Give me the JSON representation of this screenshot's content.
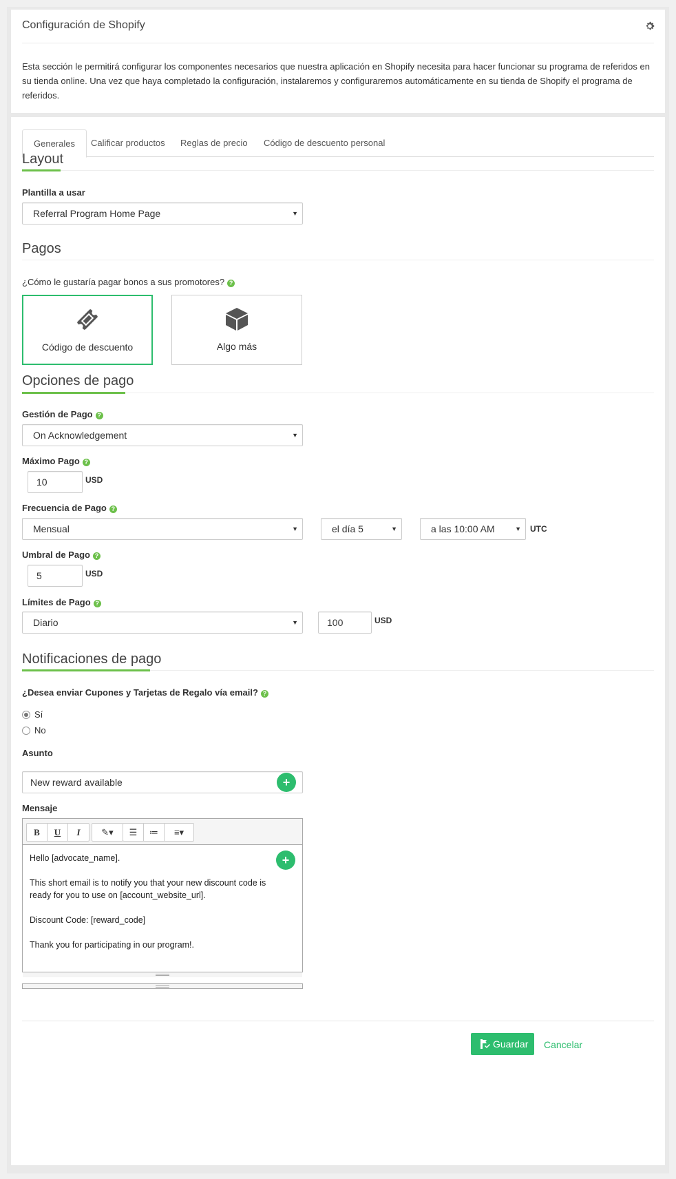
{
  "header": {
    "title": "Configuración de Shopify",
    "description": "Esta sección le permitirá configurar los componentes necesarios que nuestra aplicación en Shopify necesita para hacer funcionar su programa de referidos en su tienda online. Una vez que haya completado la configuración, instalaremos y configuraremos automáticamente en su tienda de Shopify el programa de referidos."
  },
  "tabs": [
    {
      "label": "Generales",
      "active": true
    },
    {
      "label": "Calificar productos"
    },
    {
      "label": "Reglas de precio"
    },
    {
      "label": "Código de descuento personal"
    }
  ],
  "layout": {
    "title": "Layout",
    "template_label": "Plantilla a usar",
    "template_value": "Referral Program Home Page"
  },
  "pagos": {
    "title": "Pagos",
    "question": "¿Cómo le gustaría pagar bonos a sus promotores?",
    "options": [
      {
        "label": "Código de descuento",
        "icon": "ticket-icon",
        "selected": true
      },
      {
        "label": "Algo más",
        "icon": "box-icon",
        "selected": false
      }
    ]
  },
  "opciones": {
    "title": "Opciones de pago",
    "gestion_label": "Gestión de Pago",
    "gestion_value": "On Acknowledgement",
    "maximo_label": "Máximo Pago",
    "maximo_value": "10",
    "currency": "USD",
    "frecuencia_label": "Frecuencia de Pago",
    "frecuencia_value": "Mensual",
    "dia_value": "el día 5",
    "hora_value": "a las 10:00 AM",
    "timezone": "UTC",
    "umbral_label": "Umbral de Pago",
    "umbral_value": "5",
    "limites_label": "Límites de Pago",
    "limites_value": "Diario",
    "limites_amount": "100"
  },
  "notificaciones": {
    "title": "Notificaciones de pago",
    "question": "¿Desea enviar Cupones y Tarjetas de Regalo vía email?",
    "yes_label": "Sí",
    "no_label": "No",
    "selected": "yes",
    "asunto_label": "Asunto",
    "asunto_value": "New reward available",
    "mensaje_label": "Mensaje",
    "message_lines": [
      "Hello [advocate_name].",
      "This short email is to notify you that your new discount code is ready for you to use on [account_website_url].",
      "Discount Code: [reward_code]",
      "Thank you for participating in our program!."
    ]
  },
  "footer": {
    "save_label": "Guardar",
    "cancel_label": "Cancelar"
  },
  "colors": {
    "accent": "#2dbd6e",
    "help": "#6cc04a"
  }
}
